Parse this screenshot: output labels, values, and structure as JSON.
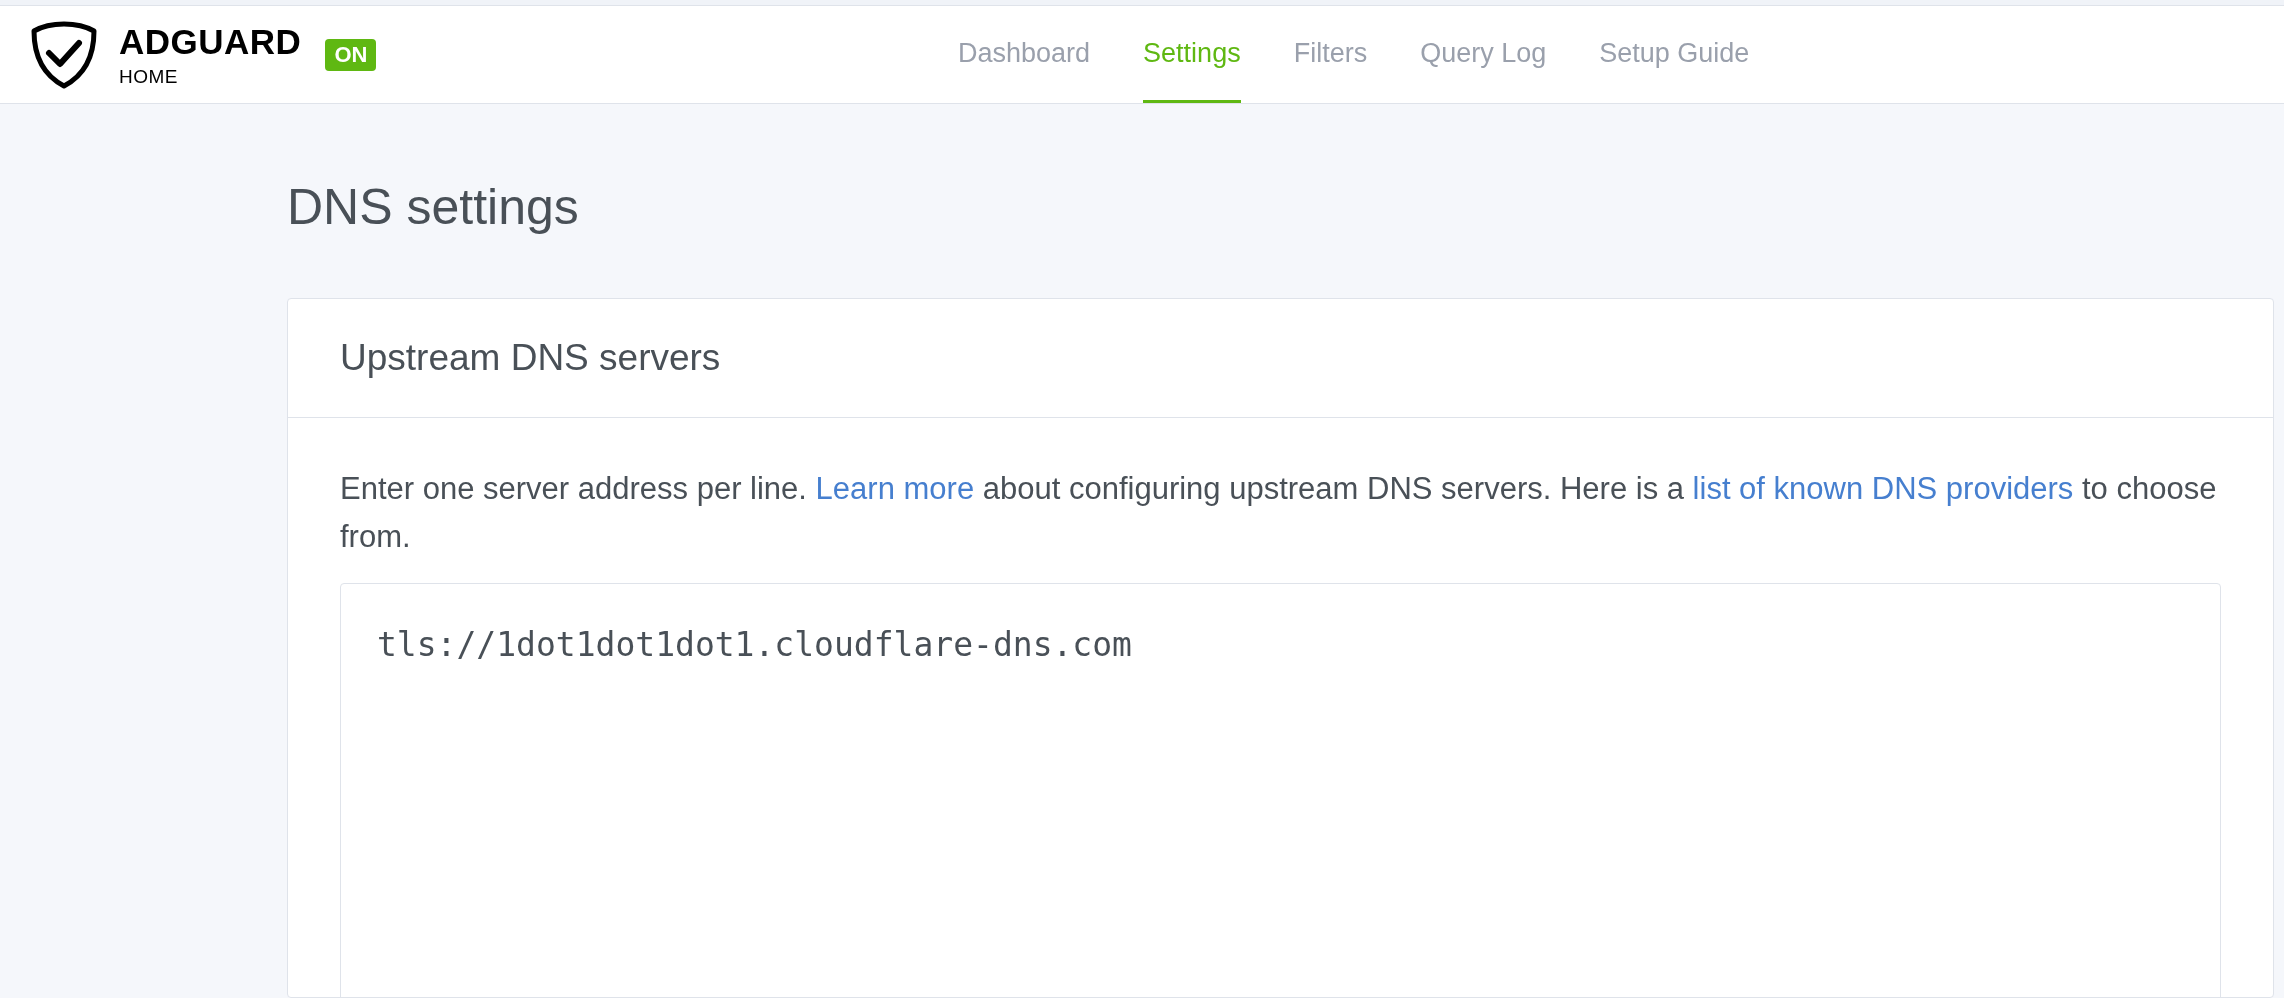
{
  "brand": {
    "name": "ADGUARD",
    "subtitle": "HOME",
    "status": "ON"
  },
  "nav": [
    {
      "label": "Dashboard",
      "selected": false
    },
    {
      "label": "Settings",
      "selected": true
    },
    {
      "label": "Filters",
      "selected": false
    },
    {
      "label": "Query Log",
      "selected": false
    },
    {
      "label": "Setup Guide",
      "selected": false
    }
  ],
  "page_title": "DNS settings",
  "card": {
    "title": "Upstream DNS servers",
    "description": [
      {
        "kind": "text",
        "text": "Enter one server address per line. "
      },
      {
        "kind": "link",
        "text": "Learn more"
      },
      {
        "kind": "text",
        "text": " about configuring upstream DNS servers. Here is a "
      },
      {
        "kind": "link",
        "text": "list of known DNS providers"
      },
      {
        "kind": "text",
        "text": " to choose from."
      }
    ],
    "upstream_servers": "tls://1dot1dot1dot1.cloudflare-dns.com"
  }
}
